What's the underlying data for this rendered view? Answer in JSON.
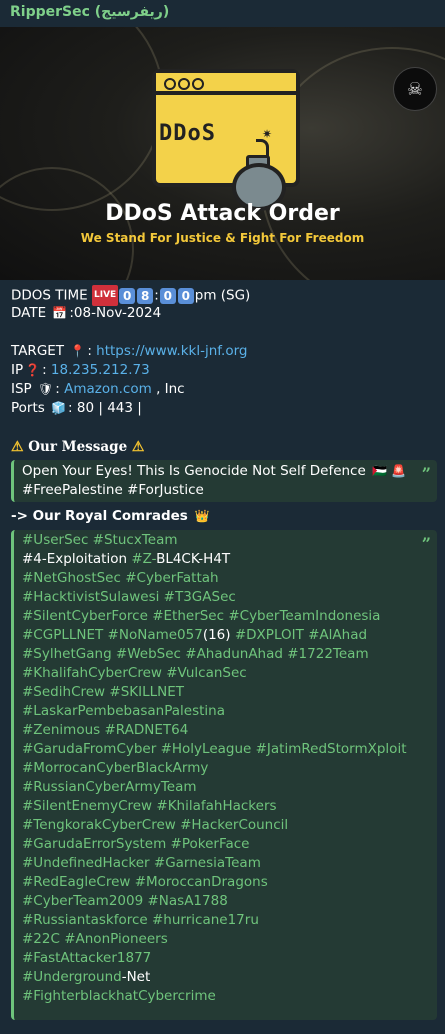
{
  "sender": "RipperSec (ريفرسيج)",
  "banner": {
    "logo_icon": "skull-badge-icon",
    "tag": "DDoS",
    "title": "DDoS Attack Order",
    "subtitle": "We Stand For Justice & Fight For Freedom"
  },
  "info": {
    "ddos_time_label": "DDOS TIME",
    "live_badge": "LIVE",
    "time_digits": [
      "0",
      "8",
      "0",
      "0"
    ],
    "time_suffix": "pm (SG)",
    "date_label": "DATE",
    "date_value": ":08-Nov-2024",
    "target_label": "TARGET",
    "target_url": "https://www.kkl-jnf.org",
    "ip_label": "IP",
    "ip_value": "18.235.212.73",
    "isp_label": "ISP",
    "isp_link": "Amazon.com",
    "isp_suffix": ", Inc",
    "ports_label": "Ports",
    "ports_value": ": 80 | 443 |"
  },
  "message": {
    "heading": "Our Message",
    "line1": "Open Your Eyes! This Is Genocide Not Self Defence",
    "line2": "#FreePalestine #ForJustice"
  },
  "comrades": {
    "heading": "-> Our Royal Comrades",
    "lines": [
      [
        {
          "t": "#UserSec #StucxTeam",
          "c": "tag"
        }
      ],
      [
        {
          "t": "#4-Exploitation ",
          "c": "w"
        },
        {
          "t": "#Z-",
          "c": "tag"
        },
        {
          "t": "BL4CK-H4T",
          "c": "w"
        }
      ],
      [
        {
          "t": "#NetGhostSec #CyberFattah",
          "c": "tag"
        }
      ],
      [
        {
          "t": "#HacktivistSulawesi #T3GASec",
          "c": "tag"
        }
      ],
      [
        {
          "t": "#SilentCyberForce #EtherSec #CyberTeamIndonesia",
          "c": "tag"
        }
      ],
      [
        {
          "t": "#CGPLLNET #NoName057",
          "c": "tag"
        },
        {
          "t": "(16) ",
          "c": "w"
        },
        {
          "t": "#DXPLOIT #AlAhad",
          "c": "tag"
        }
      ],
      [
        {
          "t": "#SylhetGang #WebSec #AhadunAhad #1722Team",
          "c": "tag"
        }
      ],
      [
        {
          "t": "#KhalifahCyberCrew #VulcanSec",
          "c": "tag"
        }
      ],
      [
        {
          "t": "#SedihCrew #SKILLNET",
          "c": "tag"
        }
      ],
      [
        {
          "t": "#LaskarPembebasanPalestina",
          "c": "tag"
        }
      ],
      [
        {
          "t": "#Zenimous #RADNET64",
          "c": "tag"
        }
      ],
      [
        {
          "t": "#GarudaFromCyber #HolyLeague  #JatimRedStormXploit",
          "c": "tag"
        }
      ],
      [
        {
          "t": "#MorrocanCyberBlackArmy",
          "c": "tag"
        }
      ],
      [
        {
          "t": "#RussianCyberArmyTeam",
          "c": "tag"
        }
      ],
      [
        {
          "t": "#SilentEnemyCrew #KhilafahHackers",
          "c": "tag"
        }
      ],
      [
        {
          "t": "#TengkorakCyberCrew #HackerCouncil",
          "c": "tag"
        }
      ],
      [
        {
          "t": "#GarudaErrorSystem #PokerFace",
          "c": "tag"
        }
      ],
      [
        {
          "t": "#UndefinedHacker #GarnesiaTeam",
          "c": "tag"
        }
      ],
      [
        {
          "t": "#RedEagleCrew #MoroccanDragons",
          "c": "tag"
        }
      ],
      [
        {
          "t": "#CyberTeam2009 #NasA1788",
          "c": "tag"
        }
      ],
      [
        {
          "t": "#Russiantaskforce #hurricane17ru",
          "c": "tag"
        }
      ],
      [
        {
          "t": "#22C #AnonPioneers",
          "c": "tag"
        }
      ],
      [
        {
          "t": "#FastAttacker1877",
          "c": "tag"
        }
      ],
      [
        {
          "t": "#Underground",
          "c": "tag"
        },
        {
          "t": "-Net",
          "c": "w"
        }
      ],
      [
        {
          "t": "#FighterblackhatCybercrime",
          "c": "tag"
        }
      ]
    ]
  },
  "colors": {
    "bubble_bg": "#1b2a36",
    "hashtag": "#6fc47c",
    "link": "#5ab1e8",
    "sender": "#7fd08a",
    "banner_accent": "#f3d24a"
  },
  "icons": {
    "live": "live-icon",
    "calendar": "calendar-icon",
    "target": "pushpin-icon",
    "ip": "question-icon",
    "isp": "shield-icon",
    "ports": "package-icon",
    "warning": "warning-icon",
    "crown": "crown-icon",
    "quote": "quote-icon"
  }
}
